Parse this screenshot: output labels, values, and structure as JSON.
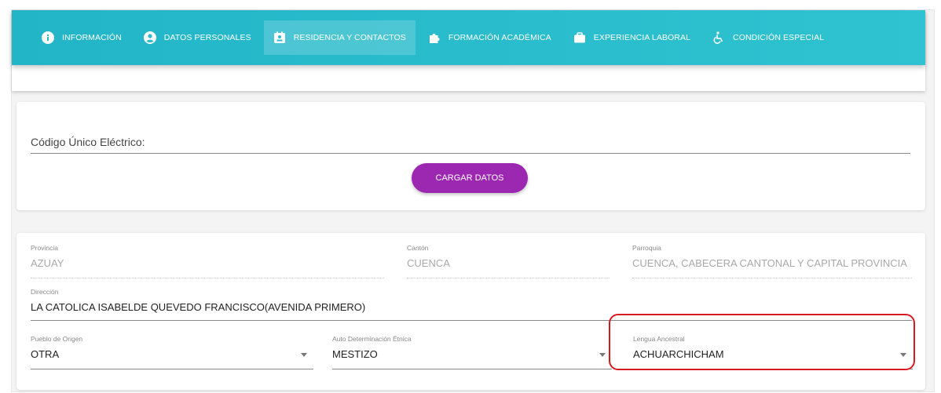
{
  "nav": {
    "tabs": [
      {
        "label": "INFORMACIÓN",
        "icon": "info-icon"
      },
      {
        "label": "DATOS PERSONALES",
        "icon": "account-circle-icon"
      },
      {
        "label": "RESIDENCIA Y CONTACTOS",
        "icon": "contact-card-icon",
        "active": true
      },
      {
        "label": "FORMACIÓN ACADÉMICA",
        "icon": "puzzle-icon"
      },
      {
        "label": "EXPERIENCIA LABORAL",
        "icon": "briefcase-icon"
      },
      {
        "label": "CONDICIÓN ESPECIAL",
        "icon": "wheelchair-icon"
      }
    ],
    "color": "#2bbccd"
  },
  "search": {
    "placeholder": "Código Único Eléctrico:",
    "button_label": "CARGAR DATOS",
    "button_color": "#9c27b0"
  },
  "residence": {
    "provincia": {
      "label": "Provincia",
      "value": "AZUAY"
    },
    "canton": {
      "label": "Cantón",
      "value": "CUENCA"
    },
    "parroquia": {
      "label": "Parroquia",
      "value": "CUENCA, CABECERA CANTONAL Y CAPITAL PROVINCIA"
    },
    "direccion": {
      "label": "Dirección",
      "value": "LA CATOLICA ISABELDE QUEVEDO FRANCISCO(AVENIDA PRIMERO)"
    },
    "pueblo": {
      "label": "Pueblo de Origen",
      "value": "OTRA"
    },
    "etnia": {
      "label": "Auto Determinación Étnica",
      "value": "MESTIZO"
    },
    "lengua": {
      "label": "Lengua Ancestral",
      "value": "ACHUARCHICHAM"
    }
  },
  "highlight_color": "#d71920"
}
